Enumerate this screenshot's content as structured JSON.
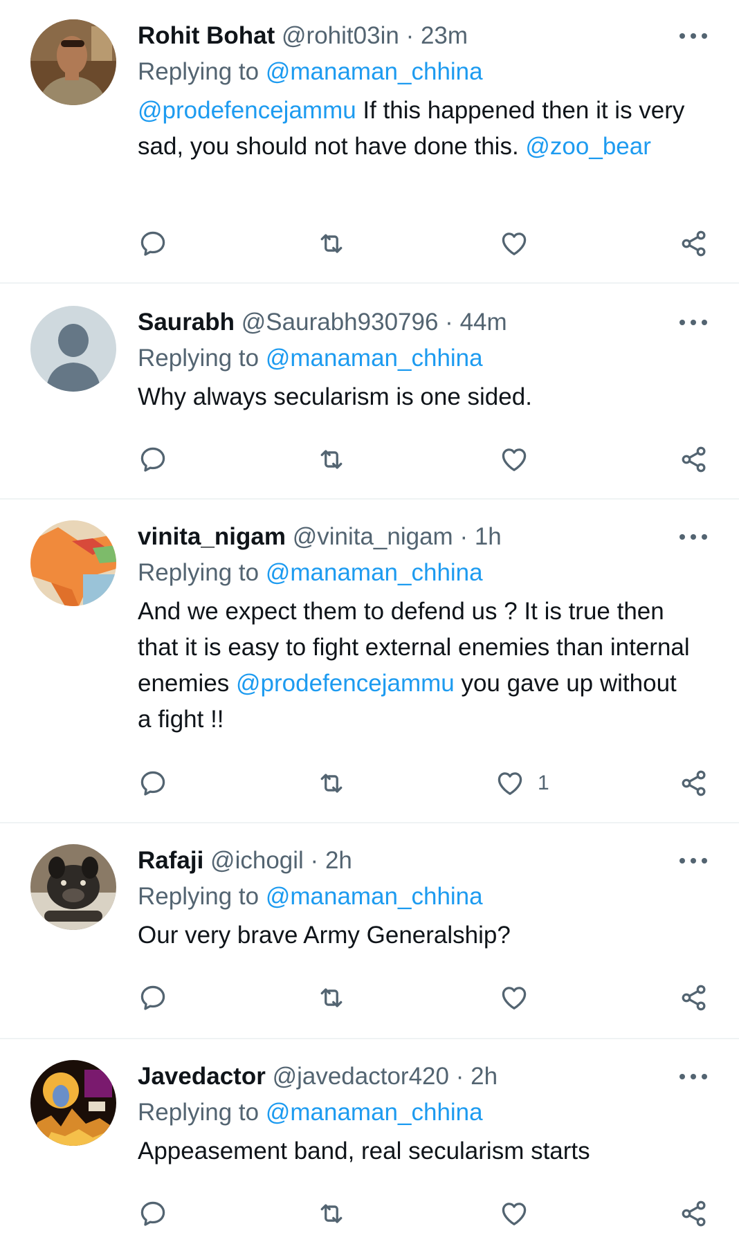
{
  "colors": {
    "link": "#1d9bf0",
    "secondary_text": "#536471",
    "primary_text": "#0f1419",
    "divider": "#eff3f4"
  },
  "icons": {
    "reply": "reply-icon",
    "retweet": "retweet-icon",
    "like": "heart-icon",
    "share": "share-icon",
    "more": "more-options-icon"
  },
  "tweets": [
    {
      "name": "Rohit Bohat",
      "handle": "@rohit03in",
      "separator": "·",
      "time": "23m",
      "replying_prefix": "Replying to",
      "replying_to": "@manaman_chhina",
      "body": {
        "mention_1": "@prodefencejammu",
        "text_1": " If this happened then it is very sad, you should not have done this. ",
        "mention_2": "@zoo_bear"
      },
      "like_count": ""
    },
    {
      "name": "Saurabh",
      "handle": "@Saurabh930796",
      "separator": "·",
      "time": "44m",
      "replying_prefix": "Replying to",
      "replying_to": "@manaman_chhina",
      "body": {
        "text_1": "Why always secularism is one sided."
      },
      "like_count": ""
    },
    {
      "name": "vinita_nigam",
      "handle": "@vinita_nigam",
      "separator": "·",
      "time": "1h",
      "replying_prefix": "Replying to",
      "replying_to": "@manaman_chhina",
      "body": {
        "text_1": "And we expect them to defend us ? It is true then that it is easy to fight external enemies than internal enemies ",
        "mention_1": "@prodefencejammu",
        "text_2": " you gave up without a fight !!"
      },
      "like_count": "1"
    },
    {
      "name": "Rafaji",
      "handle": "@ichogil",
      "separator": "·",
      "time": "2h",
      "replying_prefix": "Replying to",
      "replying_to": "@manaman_chhina",
      "body": {
        "text_1": "Our very brave Army Generalship?"
      },
      "like_count": ""
    },
    {
      "name": "Javedactor",
      "handle": "@javedactor420",
      "separator": "·",
      "time": "2h",
      "replying_prefix": "Replying to",
      "replying_to": "@manaman_chhina",
      "body": {
        "text_1": "Appeasement band, real secularism starts"
      },
      "like_count": ""
    }
  ]
}
